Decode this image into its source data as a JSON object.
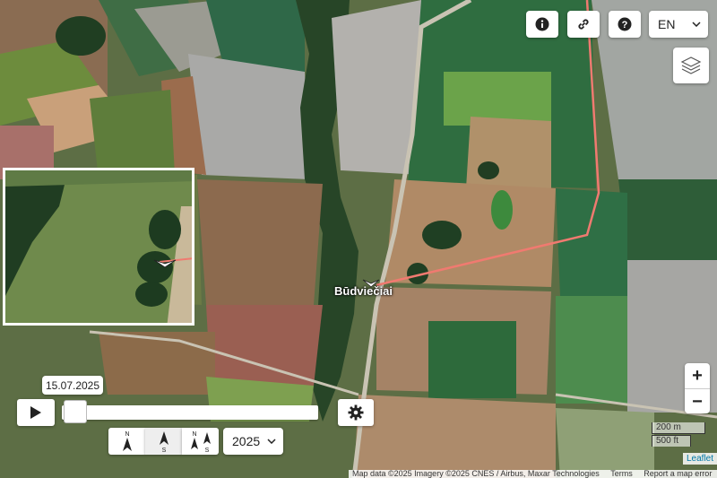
{
  "toolbar": {
    "info_icon": "info-icon",
    "link_icon": "link-icon",
    "help_icon": "help-icon",
    "language": "EN",
    "layers_icon": "layers-icon"
  },
  "map": {
    "place_label": "Būdviečiai",
    "route_color": "#f07a70"
  },
  "zoom": {
    "in_label": "+",
    "out_label": "−"
  },
  "scale": {
    "metric": "200 m",
    "imperial": "500 ft"
  },
  "attribution": {
    "text": "Map data ©2025 Imagery ©2025 CNES / Airbus, Maxar Technologies",
    "terms": "Terms",
    "report": "Report a map error",
    "leaflet": "Leaflet"
  },
  "timeline": {
    "date": "15.07.2025",
    "year": "2025"
  },
  "orientation": {
    "n_label": "N",
    "s_label": "S"
  }
}
